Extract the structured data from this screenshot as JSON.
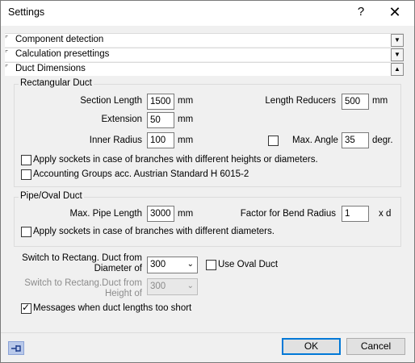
{
  "window": {
    "title": "Settings",
    "help_icon": "?",
    "close_icon": "✕"
  },
  "sections": {
    "component_detection": "Component detection",
    "calculation_presettings": "Calculation presettings",
    "duct_dimensions": "Duct Dimensions",
    "collapsed_arrow": "▼",
    "expanded_arrow": "▲"
  },
  "rectangular_duct": {
    "title": "Rectangular Duct",
    "section_length_label": "Section Length",
    "section_length_value": "1500",
    "section_length_unit": "mm",
    "length_reducers_label": "Length Reducers",
    "length_reducers_value": "500",
    "length_reducers_unit": "mm",
    "extension_label": "Extension",
    "extension_value": "50",
    "extension_unit": "mm",
    "inner_radius_label": "Inner Radius",
    "inner_radius_value": "100",
    "inner_radius_unit": "mm",
    "max_angle_checked": false,
    "max_angle_label": "Max. Angle",
    "max_angle_value": "35",
    "max_angle_unit": "degr.",
    "apply_sockets_label": "Apply sockets in case of branches with different heights or diameters.",
    "apply_sockets_checked": false,
    "accounting_groups_label": "Accounting Groups acc. Austrian Standard H 6015-2",
    "accounting_groups_checked": false
  },
  "pipe_oval_duct": {
    "title": "Pipe/Oval Duct",
    "max_pipe_length_label": "Max. Pipe Length",
    "max_pipe_length_value": "3000",
    "max_pipe_length_unit": "mm",
    "factor_bend_radius_label": "Factor for Bend Radius",
    "factor_bend_radius_value": "1",
    "factor_bend_radius_unit": "x d",
    "apply_sockets_label": "Apply sockets in case of branches with different diameters.",
    "apply_sockets_checked": false
  },
  "switch": {
    "diameter_label_line1": "Switch to Rectang. Duct from",
    "diameter_label_line2": "Diameter of",
    "diameter_value": "300",
    "use_oval_duct_label": "Use Oval Duct",
    "use_oval_duct_checked": false,
    "height_label_line1": "Switch to Rectang.Duct from",
    "height_label_line2": "Height of",
    "height_value": "300",
    "combo_arrow": "⌄"
  },
  "messages": {
    "label": "Messages when duct lengths too short",
    "checked": true
  },
  "footer": {
    "ok_label": "OK",
    "cancel_label": "Cancel",
    "pin_icon": "pin-icon"
  }
}
